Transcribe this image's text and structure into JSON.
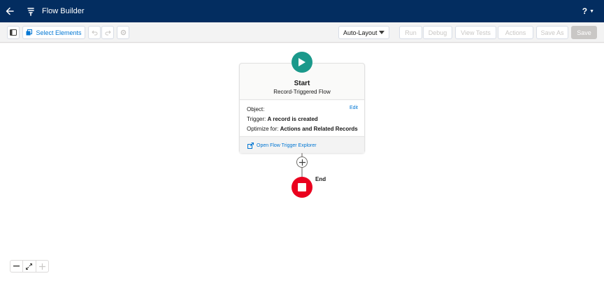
{
  "header": {
    "title": "Flow Builder",
    "help_label": "?",
    "caret": "▼"
  },
  "toolbar": {
    "select_elements_label": "Select Elements",
    "auto_layout_label": "Auto-Layout",
    "run_label": "Run",
    "debug_label": "Debug",
    "view_tests_label": "View Tests",
    "actions_label": "Actions",
    "save_as_label": "Save As",
    "save_label": "Save"
  },
  "start_node": {
    "title": "Start",
    "subtitle": "Record-Triggered Flow",
    "object_label": "Object:",
    "object_value": "",
    "edit_label": "Edit",
    "trigger_label": "Trigger:",
    "trigger_value": "A record is created",
    "optimize_label": "Optimize for:",
    "optimize_value": "Actions and Related Records",
    "explorer_link": "Open Flow Trigger Explorer"
  },
  "end_node": {
    "label": "End"
  },
  "colors": {
    "header_bg": "#032d60",
    "start": "#1b998b",
    "end": "#ea001e",
    "link": "#0176d3"
  },
  "icons": [
    "back-arrow-icon",
    "flow-icon",
    "panel-toggle-icon",
    "select-elements-icon",
    "undo-icon",
    "redo-icon",
    "settings-icon",
    "dropdown-caret-icon",
    "play-icon",
    "external-link-icon",
    "plus-icon",
    "stop-icon",
    "zoom-out-icon",
    "fit-view-icon",
    "zoom-in-icon"
  ]
}
